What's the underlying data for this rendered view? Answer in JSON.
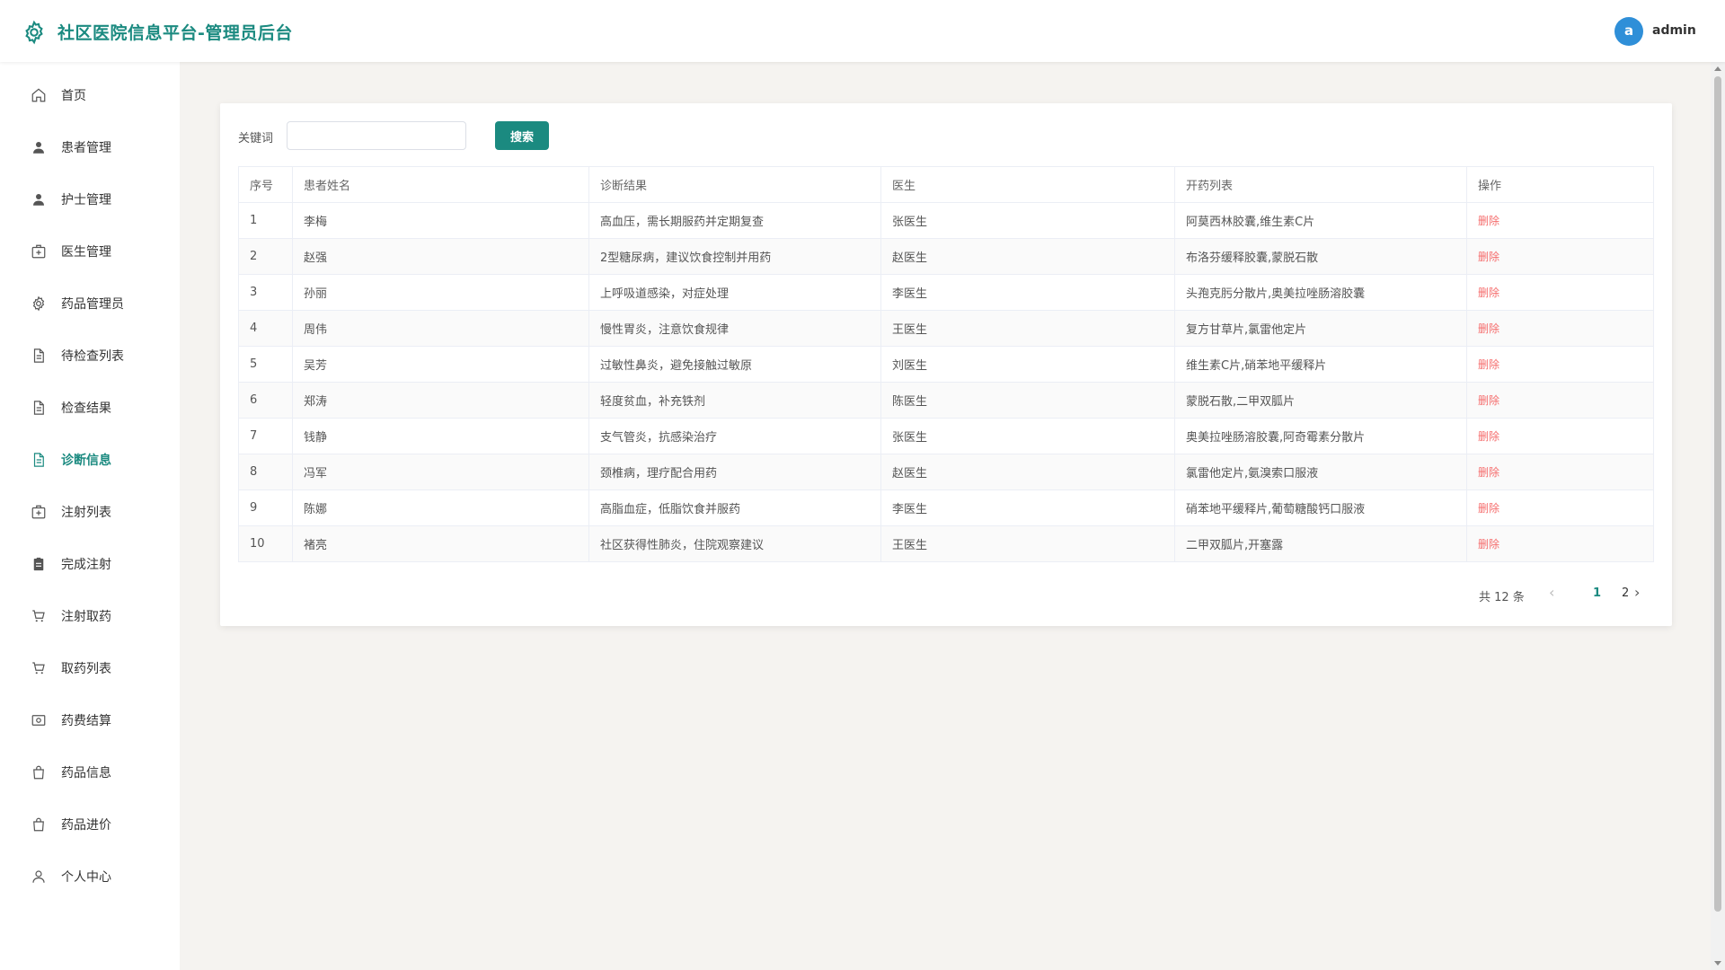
{
  "header": {
    "title": "社区医院信息平台-管理员后台",
    "avatar_letter": "a",
    "username": "admin"
  },
  "sidebar": {
    "items": [
      {
        "label": "首页",
        "icon": "home-icon"
      },
      {
        "label": "患者管理",
        "icon": "user-filled-icon"
      },
      {
        "label": "护士管理",
        "icon": "user-filled-icon"
      },
      {
        "label": "医生管理",
        "icon": "first-aid-kit-icon"
      },
      {
        "label": "药品管理员",
        "icon": "gear-icon"
      },
      {
        "label": "待检查列表",
        "icon": "document-icon"
      },
      {
        "label": "检查结果",
        "icon": "document-icon"
      },
      {
        "label": "诊断信息",
        "icon": "document-icon",
        "active": true
      },
      {
        "label": "注射列表",
        "icon": "first-aid-kit-icon"
      },
      {
        "label": "完成注射",
        "icon": "clipboard-icon"
      },
      {
        "label": "注射取药",
        "icon": "cart-icon"
      },
      {
        "label": "取药列表",
        "icon": "cart-icon"
      },
      {
        "label": "药费结算",
        "icon": "money-icon"
      },
      {
        "label": "药品信息",
        "icon": "bag-icon"
      },
      {
        "label": "药品进价",
        "icon": "bag-icon"
      },
      {
        "label": "个人中心",
        "icon": "user-outline-icon"
      }
    ]
  },
  "search": {
    "label": "关键词",
    "value": "",
    "placeholder": "",
    "button": "搜索"
  },
  "table": {
    "headers": [
      "序号",
      "患者姓名",
      "诊断结果",
      "医生",
      "开药列表",
      "操作"
    ],
    "action_label": "删除",
    "rows": [
      [
        "1",
        "李梅",
        "高血压，需长期服药并定期复查",
        "张医生",
        "阿莫西林胶囊,维生素C片"
      ],
      [
        "2",
        "赵强",
        "2型糖尿病，建议饮食控制并用药",
        "赵医生",
        "布洛芬缓释胶囊,蒙脱石散"
      ],
      [
        "3",
        "孙丽",
        "上呼吸道感染，对症处理",
        "李医生",
        "头孢克肟分散片,奥美拉唑肠溶胶囊"
      ],
      [
        "4",
        "周伟",
        "慢性胃炎，注意饮食规律",
        "王医生",
        "复方甘草片,氯雷他定片"
      ],
      [
        "5",
        "吴芳",
        "过敏性鼻炎，避免接触过敏原",
        "刘医生",
        "维生素C片,硝苯地平缓释片"
      ],
      [
        "6",
        "郑涛",
        "轻度贫血，补充铁剂",
        "陈医生",
        "蒙脱石散,二甲双胍片"
      ],
      [
        "7",
        "钱静",
        "支气管炎，抗感染治疗",
        "张医生",
        "奥美拉唑肠溶胶囊,阿奇霉素分散片"
      ],
      [
        "8",
        "冯军",
        "颈椎病，理疗配合用药",
        "赵医生",
        "氯雷他定片,氨溴索口服液"
      ],
      [
        "9",
        "陈娜",
        "高脂血症，低脂饮食并服药",
        "李医生",
        "硝苯地平缓释片,葡萄糖酸钙口服液"
      ],
      [
        "10",
        "褚亮",
        "社区获得性肺炎，住院观察建议",
        "王医生",
        "二甲双胍片,开塞露"
      ]
    ]
  },
  "pagination": {
    "total": "共 12 条",
    "pages": [
      "1",
      "2"
    ],
    "current": "1"
  },
  "colors": {
    "accent": "#1b8a80",
    "danger": "#f56c6c",
    "avatar": "#2f8fd8"
  }
}
